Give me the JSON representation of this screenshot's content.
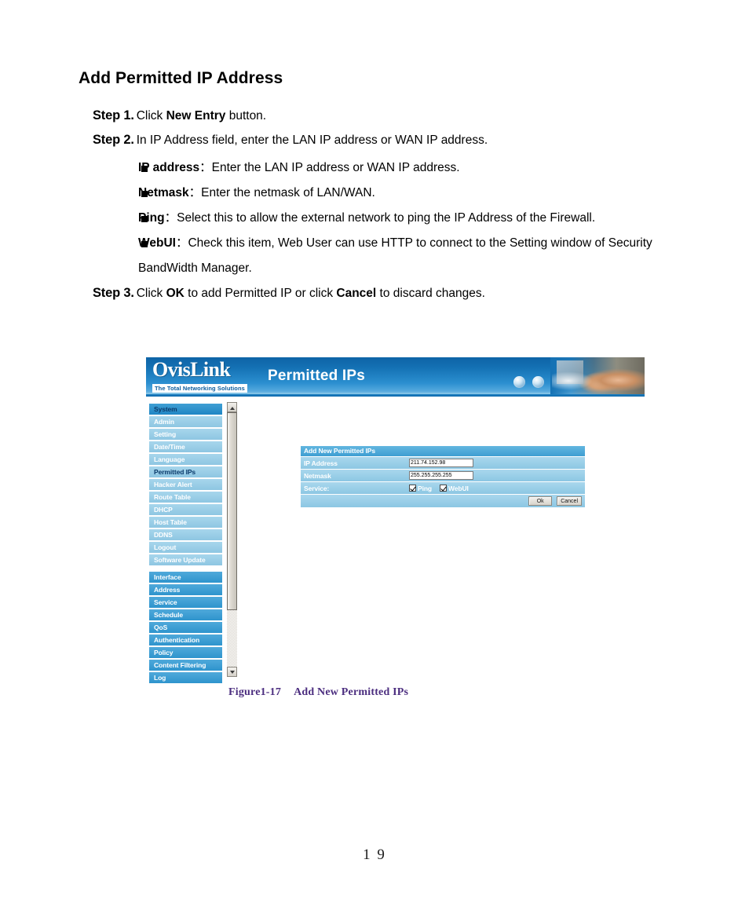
{
  "document": {
    "heading": "Add Permitted IP Address",
    "page_number": "1 9",
    "steps": {
      "step1": {
        "label": "Step 1.",
        "pre": "Click ",
        "bold": "New Entry",
        "post": " button."
      },
      "step2": {
        "label": "Step 2.",
        "text": "In IP Address field, enter the LAN IP address or WAN IP address."
      },
      "step3": {
        "label": "Step 3.",
        "pre": "Click ",
        "bold1": "OK",
        "mid": " to add Permitted IP or click ",
        "bold2": "Cancel",
        "post": " to discard changes."
      }
    },
    "bullets": [
      {
        "term": "IP address",
        "separator": "：",
        "description": "Enter the LAN IP address or WAN IP address."
      },
      {
        "term": "Netmask",
        "separator": "：",
        "description": "Enter the netmask of LAN/WAN."
      },
      {
        "term": "Ping",
        "separator": "：",
        "description": "Select this to allow the external network to ping the IP Address of the Firewall."
      },
      {
        "term": "WebUI",
        "separator": "：",
        "description": "Check this item, Web User can use HTTP to connect to the Setting window of Security BandWidth Manager."
      }
    ],
    "figure_caption": {
      "number": "Figure1-17",
      "title": "Add New Permitted IPs"
    }
  },
  "screenshot": {
    "header": {
      "logo_word": "OvisLink",
      "logo_tagline": "The Total Networking Solutions",
      "page_title": "Permitted IPs",
      "icons": [
        "globe-icon",
        "globe-icon"
      ],
      "photo_alt": "man-and-child-at-computer-photo"
    },
    "sidebar": {
      "groups": [
        {
          "type": "group",
          "label": "System",
          "items": [
            {
              "label": "Admin",
              "active": false
            },
            {
              "label": "Setting",
              "active": false
            },
            {
              "label": "Date/Time",
              "active": false
            },
            {
              "label": "Language",
              "active": false
            },
            {
              "label": "Permitted IPs",
              "active": true
            },
            {
              "label": "Hacker Alert",
              "active": false
            },
            {
              "label": "Route Table",
              "active": false
            },
            {
              "label": "DHCP",
              "active": false
            },
            {
              "label": "Host Table",
              "active": false
            },
            {
              "label": "DDNS",
              "active": false
            },
            {
              "label": "Logout",
              "active": false
            },
            {
              "label": "Software Update",
              "active": false
            }
          ]
        }
      ],
      "majors": [
        {
          "label": "Interface"
        },
        {
          "label": "Address"
        },
        {
          "label": "Service"
        },
        {
          "label": "Schedule"
        },
        {
          "label": "QoS"
        },
        {
          "label": "Authentication"
        },
        {
          "label": "Policy"
        },
        {
          "label": "Content Filtering"
        },
        {
          "label": "Log"
        }
      ]
    },
    "form": {
      "title": "Add New Permitted IPs",
      "fields": [
        {
          "label": "IP Address",
          "value": "211.74.152.98"
        },
        {
          "label": "Netmask",
          "value": "255.255.255.255"
        }
      ],
      "service": {
        "label": "Service:",
        "options": [
          {
            "label": "Ping",
            "checked": true
          },
          {
            "label": "WebUI",
            "checked": true
          }
        ]
      },
      "buttons": {
        "ok": "Ok",
        "cancel": "Cancel"
      }
    },
    "colors": {
      "header_blue": "#1471b4",
      "group_blue": "#2e94cd",
      "sub_blue": "#8ec6e2",
      "panel_title_blue": "#3f9ed2",
      "caption_purple": "#4b2d7f"
    }
  }
}
